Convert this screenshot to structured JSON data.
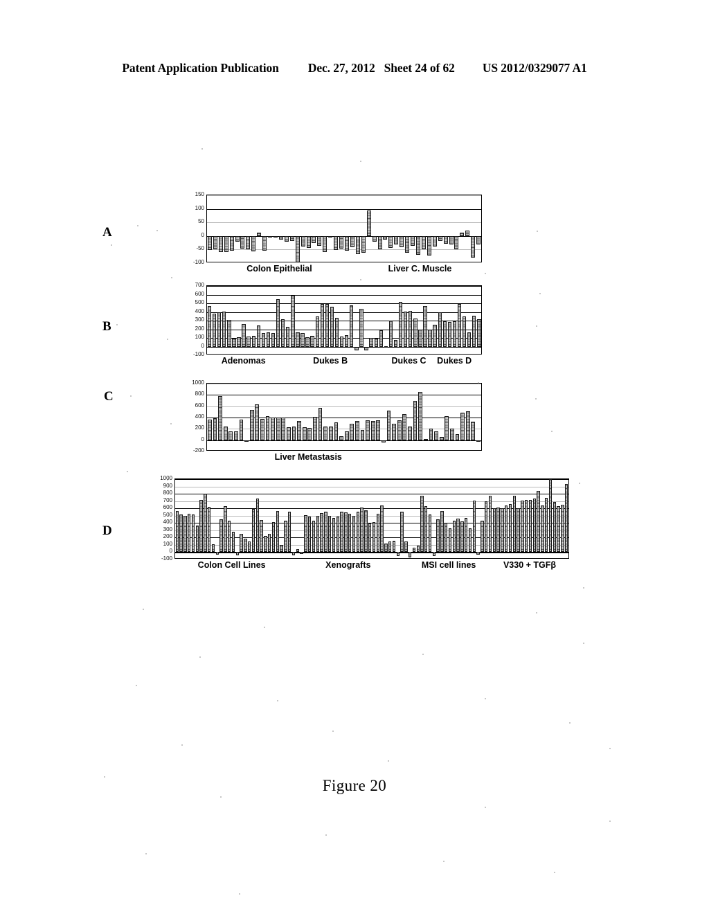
{
  "header": {
    "publication": "Patent Application Publication",
    "date": "Dec. 27, 2012",
    "sheet": "Sheet 24 of 62",
    "patent_number": "US 2012/0329077 A1"
  },
  "figure": {
    "caption": "Figure 20",
    "panel_letters": [
      "A",
      "B",
      "C",
      "D"
    ]
  },
  "chart_data": [
    {
      "panel": "A",
      "type": "bar",
      "title": "",
      "xlabel": "",
      "ylabel": "",
      "ylim": [
        -100,
        150
      ],
      "yticks": [
        150,
        100,
        50,
        0,
        -50,
        -100
      ],
      "grid": true,
      "legend": "none",
      "group_labels": [
        "Colon Epithelial",
        "Liver C. Muscle"
      ],
      "values": [
        -52,
        -48,
        -60,
        -58,
        -53,
        -22,
        -47,
        -50,
        -56,
        12,
        -55,
        -5,
        -3,
        -12,
        -20,
        -18,
        -97,
        -38,
        -44,
        -25,
        -35,
        -60,
        -6,
        -52,
        -47,
        -55,
        -42,
        -66,
        -62,
        95,
        -22,
        -50,
        -14,
        -45,
        -32,
        -42,
        -62,
        -35,
        -70,
        -48,
        -72,
        -38,
        -18,
        -28,
        -30,
        -50,
        12,
        20,
        -80,
        -30
      ]
    },
    {
      "panel": "B",
      "type": "bar",
      "title": "",
      "xlabel": "",
      "ylabel": "",
      "ylim": [
        -100,
        700
      ],
      "yticks": [
        700,
        600,
        500,
        400,
        300,
        200,
        100,
        0,
        -100
      ],
      "grid": true,
      "legend": "none",
      "group_labels": [
        "Adenomas",
        "Dukes B",
        "Dukes C",
        "Dukes D"
      ],
      "values": [
        470,
        380,
        395,
        405,
        310,
        95,
        105,
        260,
        120,
        125,
        245,
        160,
        165,
        160,
        550,
        320,
        225,
        585,
        165,
        155,
        110,
        125,
        345,
        490,
        495,
        460,
        335,
        115,
        130,
        475,
        -40,
        440,
        -45,
        100,
        95,
        185,
        5,
        300,
        80,
        520,
        405,
        410,
        325,
        200,
        470,
        195,
        255,
        395,
        290,
        285,
        290,
        490,
        345,
        165,
        355,
        315
      ]
    },
    {
      "panel": "C",
      "type": "bar",
      "title": "",
      "xlabel": "",
      "ylabel": "",
      "ylim": [
        -200,
        1000
      ],
      "yticks": [
        1000,
        800,
        600,
        400,
        200,
        0,
        -200
      ],
      "grid": true,
      "legend": "none",
      "group_labels": [
        "Liver Metastasis"
      ],
      "values": [
        360,
        385,
        780,
        235,
        150,
        160,
        365,
        -25,
        530,
        635,
        375,
        420,
        395,
        400,
        395,
        225,
        235,
        335,
        225,
        215,
        410,
        570,
        240,
        235,
        310,
        70,
        155,
        295,
        340,
        175,
        345,
        340,
        350,
        -45,
        525,
        290,
        345,
        460,
        245,
        690,
        855,
        15,
        205,
        150,
        55,
        430,
        205,
        110,
        490,
        505,
        330,
        -20
      ]
    },
    {
      "panel": "D",
      "type": "bar",
      "title": "",
      "xlabel": "",
      "ylabel": "",
      "ylim": [
        -100,
        1000
      ],
      "yticks": [
        1000,
        900,
        800,
        700,
        600,
        500,
        400,
        300,
        200,
        100,
        0,
        -100
      ],
      "grid": true,
      "legend": "none",
      "group_labels": [
        "Colon Cell Lines",
        "Xenografts",
        "MSI cell lines",
        "V330 + TGFβ"
      ],
      "values": [
        560,
        520,
        500,
        530,
        520,
        360,
        720,
        805,
        620,
        105,
        -35,
        450,
        630,
        430,
        280,
        -45,
        250,
        185,
        150,
        590,
        735,
        440,
        220,
        255,
        415,
        560,
        100,
        430,
        550,
        -40,
        40,
        -20,
        510,
        490,
        430,
        495,
        540,
        555,
        500,
        470,
        490,
        555,
        545,
        530,
        495,
        555,
        610,
        570,
        390,
        410,
        530,
        640,
        120,
        145,
        155,
        -55,
        555,
        145,
        -70,
        60,
        85,
        770,
        630,
        520,
        -50,
        450,
        565,
        405,
        325,
        430,
        460,
        425,
        470,
        330,
        710,
        -35,
        435,
        695,
        775,
        600,
        610,
        600,
        640,
        660,
        770,
        600,
        710,
        720,
        720,
        730,
        840,
        640,
        740,
        1000,
        690,
        630,
        650,
        935
      ]
    }
  ]
}
